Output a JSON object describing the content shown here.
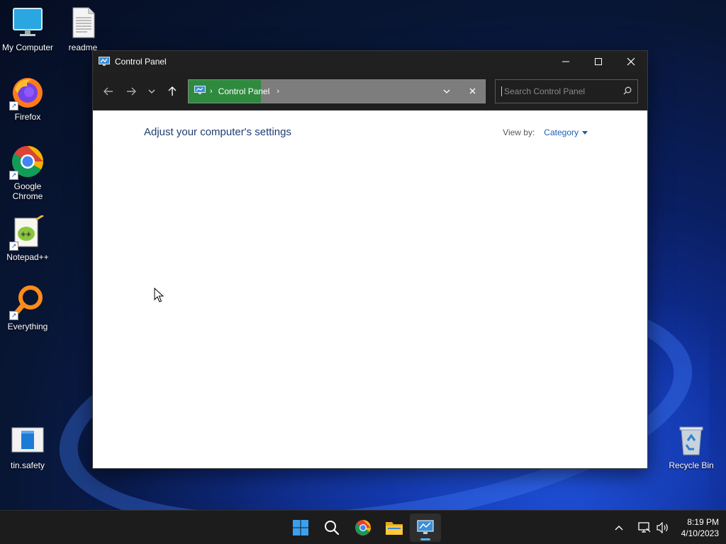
{
  "desktop": {
    "icons": [
      {
        "label": "My Computer"
      },
      {
        "label": "readme"
      },
      {
        "label": "Firefox"
      },
      {
        "label": "Google Chrome"
      },
      {
        "label": "Notepad++"
      },
      {
        "label": "Everything"
      },
      {
        "label": "tin.safety"
      },
      {
        "label": "Recycle Bin"
      }
    ]
  },
  "window": {
    "title": "Control Panel",
    "address": {
      "crumb": "Control Panel"
    },
    "search": {
      "placeholder": "Search Control Panel"
    },
    "content": {
      "heading": "Adjust your computer's settings",
      "view_by_label": "View by:",
      "view_by_value": "Category"
    }
  },
  "taskbar": {
    "clock": {
      "time": "8:19 PM",
      "date": "4/10/2023"
    }
  },
  "colors": {
    "accent": "#1a5fb4",
    "address_highlight": "#2e8b3e",
    "heading": "#1e3c72"
  }
}
